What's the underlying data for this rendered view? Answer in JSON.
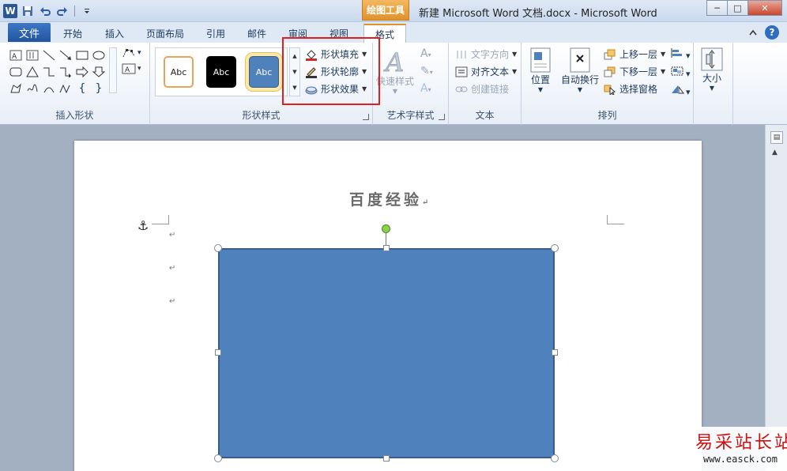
{
  "titlebar": {
    "app_icon": "W",
    "qat_icons": [
      "save-icon",
      "undo-icon",
      "redo-icon",
      "customize-qat-icon"
    ],
    "context_tab": "绘图工具",
    "window_title": "新建 Microsoft Word 文档.docx  -  Microsoft Word",
    "controls": {
      "minimize": "─",
      "maximize": "□",
      "close": "✕"
    }
  },
  "tabs": {
    "file": "文件",
    "items": [
      "开始",
      "插入",
      "页面布局",
      "引用",
      "邮件",
      "审阅",
      "视图"
    ],
    "active": "格式",
    "help": "?"
  },
  "ribbon": {
    "insert_shapes": {
      "label": "插入形状"
    },
    "shape_styles": {
      "label": "形状样式",
      "presets": [
        "Abc",
        "Abc",
        "Abc"
      ],
      "fill": "形状填充",
      "outline": "形状轮廓",
      "effects": "形状效果"
    },
    "wordart": {
      "label": "艺术字样式",
      "quick_styles": "快速样式"
    },
    "text": {
      "label": "文本",
      "direction": "文字方向",
      "align": "对齐文本",
      "link": "创建链接"
    },
    "arrange": {
      "label": "排列",
      "position": "位置",
      "wrap": "自动换行",
      "forward": "上移一层",
      "backward": "下移一层",
      "selection_pane": "选择窗格"
    },
    "size": {
      "label": "大小"
    }
  },
  "document": {
    "heading": "百度经验",
    "paragraph_mark": "↵",
    "shape_fill": "#4f81bd",
    "shape_border": "#385d8a"
  },
  "watermark": {
    "text": "易采站长站",
    "url": "www.easck.com"
  },
  "colors": {
    "accent_orange": "#e0922b",
    "highlight_red": "#e02020",
    "file_tab_blue": "#2b5797"
  }
}
